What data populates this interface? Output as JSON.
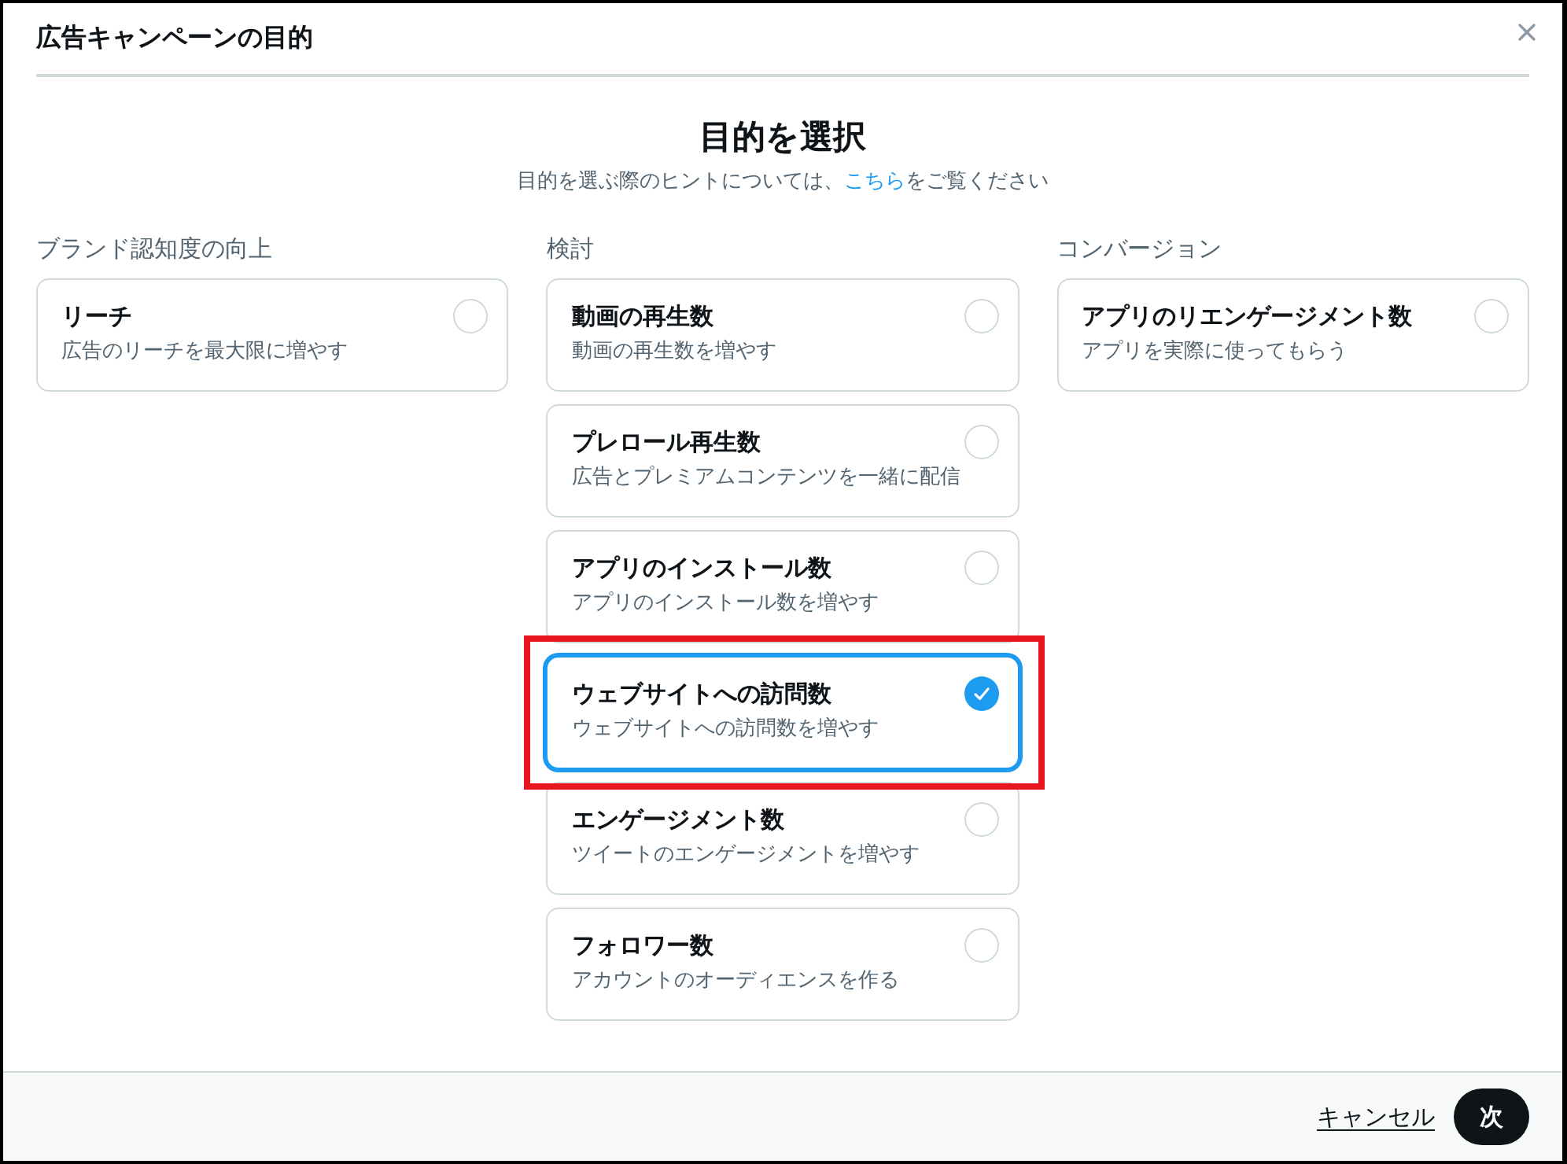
{
  "dialog": {
    "title": "広告キャンペーンの目的"
  },
  "heading": "目的を選択",
  "hint": {
    "before": "目的を選ぶ際のヒントについては、",
    "link": "こちら",
    "after": "をご覧ください"
  },
  "columns": [
    {
      "heading": "ブランド認知度の向上",
      "options": [
        {
          "title": "リーチ",
          "description": "広告のリーチを最大限に増やす",
          "selected": false,
          "highlighted": false
        }
      ]
    },
    {
      "heading": "検討",
      "options": [
        {
          "title": "動画の再生数",
          "description": "動画の再生数を増やす",
          "selected": false,
          "highlighted": false
        },
        {
          "title": "プレロール再生数",
          "description": "広告とプレミアムコンテンツを一緒に配信",
          "selected": false,
          "highlighted": false
        },
        {
          "title": "アプリのインストール数",
          "description": "アプリのインストール数を増やす",
          "selected": false,
          "highlighted": false
        },
        {
          "title": "ウェブサイトへの訪問数",
          "description": "ウェブサイトへの訪問数を増やす",
          "selected": true,
          "highlighted": true
        },
        {
          "title": "エンゲージメント数",
          "description": "ツイートのエンゲージメントを増やす",
          "selected": false,
          "highlighted": false
        },
        {
          "title": "フォロワー数",
          "description": "アカウントのオーディエンスを作る",
          "selected": false,
          "highlighted": false
        }
      ]
    },
    {
      "heading": "コンバージョン",
      "options": [
        {
          "title": "アプリのリエンゲージメント数",
          "description": "アプリを実際に使ってもらう",
          "selected": false,
          "highlighted": false
        }
      ]
    }
  ],
  "footer": {
    "cancel": "キャンセル",
    "next": "次"
  }
}
